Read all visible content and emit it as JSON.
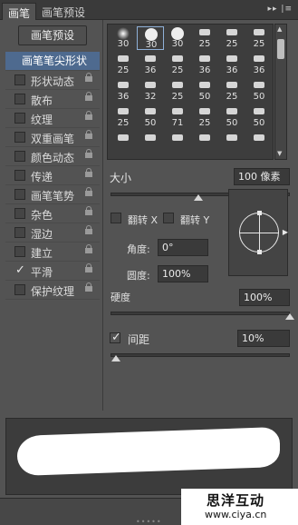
{
  "tabs": [
    {
      "label": "画笔",
      "active": true
    },
    {
      "label": "画笔预设",
      "active": false
    }
  ],
  "panel_icons": {
    "collapse": "double-right-arrow-icon",
    "menu": "panel-menu-icon"
  },
  "preset_button": "画笔预设",
  "categories": [
    {
      "label": "画笔笔尖形状",
      "checked": null,
      "locked": false,
      "active": true
    },
    {
      "label": "形状动态",
      "checked": false,
      "locked": true
    },
    {
      "label": "散布",
      "checked": false,
      "locked": true
    },
    {
      "label": "纹理",
      "checked": false,
      "locked": true
    },
    {
      "label": "双重画笔",
      "checked": false,
      "locked": true
    },
    {
      "label": "颜色动态",
      "checked": false,
      "locked": true
    },
    {
      "label": "传递",
      "checked": false,
      "locked": true
    },
    {
      "label": "画笔笔势",
      "checked": false,
      "locked": true
    },
    {
      "label": "杂色",
      "checked": false,
      "locked": true
    },
    {
      "label": "湿边",
      "checked": false,
      "locked": true
    },
    {
      "label": "建立",
      "checked": false,
      "locked": true
    },
    {
      "label": "平滑",
      "checked": true,
      "locked": true
    },
    {
      "label": "保护纹理",
      "checked": false,
      "locked": true
    }
  ],
  "brush_sizes": [
    [
      "30",
      "30",
      "30",
      "25",
      "25",
      "25"
    ],
    [
      "25",
      "36",
      "25",
      "36",
      "36",
      "36"
    ],
    [
      "36",
      "32",
      "25",
      "50",
      "25",
      "50"
    ],
    [
      "25",
      "50",
      "71",
      "25",
      "50",
      "50"
    ],
    [
      "",
      "",
      "",
      "",
      "",
      ""
    ]
  ],
  "selected_brush": {
    "row": 0,
    "col": 1
  },
  "size": {
    "label": "大小",
    "value": "100 像素",
    "slider": 0.5
  },
  "flip_x": {
    "label": "翻转 X",
    "checked": false
  },
  "flip_y": {
    "label": "翻转 Y",
    "checked": false
  },
  "angle": {
    "label": "角度:",
    "value": "0°"
  },
  "roundness": {
    "label": "圆度:",
    "value": "100%"
  },
  "hardness": {
    "label": "硬度",
    "value": "100%",
    "slider": 1.0
  },
  "spacing": {
    "label": "间距",
    "value": "10%",
    "checked": true,
    "slider": 0.02
  },
  "watermark": {
    "name": "思洋互动",
    "url": "www.ciya.cn"
  },
  "colors": {
    "selection": "#4e6a8f",
    "panel": "#535353"
  }
}
